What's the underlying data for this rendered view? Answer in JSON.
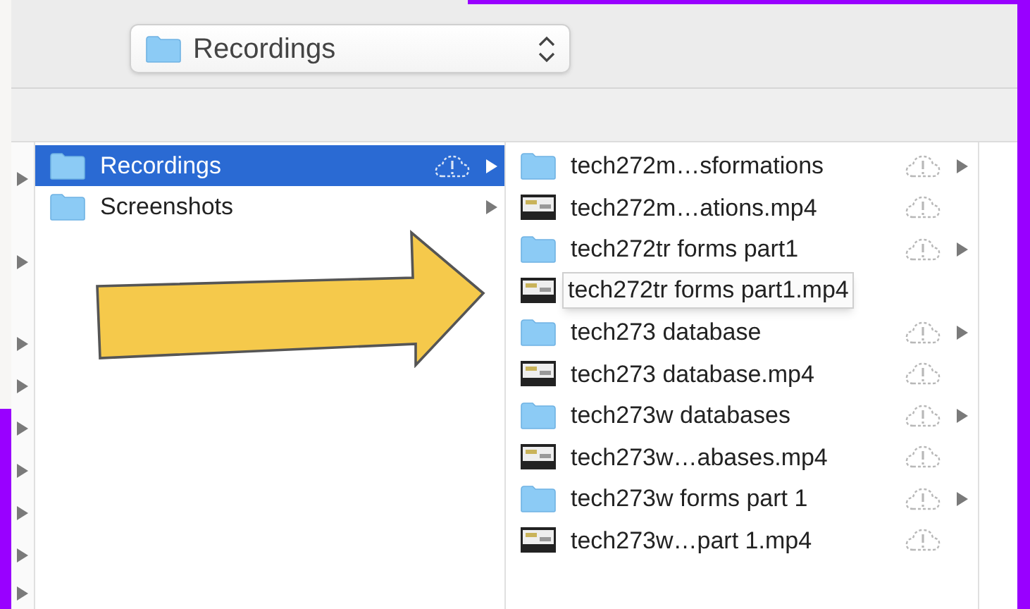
{
  "path_popup": {
    "label": "Recordings"
  },
  "parent_column": [
    {
      "name": "Recordings",
      "kind": "folder",
      "selected": true,
      "cloud": true
    },
    {
      "name": "Screenshots",
      "kind": "folder",
      "selected": false,
      "cloud": false
    }
  ],
  "contents_column": [
    {
      "name": "tech272m…sformations",
      "kind": "folder",
      "cloud": true,
      "expanded": false
    },
    {
      "name": "tech272m…ations.mp4",
      "kind": "video",
      "cloud": true,
      "expanded": false
    },
    {
      "name": "tech272tr forms part1",
      "kind": "folder",
      "cloud": true,
      "expanded": false
    },
    {
      "name": "tech272tr forms part1.mp4",
      "kind": "video",
      "cloud": false,
      "expanded": true
    },
    {
      "name": "tech273 database",
      "kind": "folder",
      "cloud": true,
      "expanded": false
    },
    {
      "name": "tech273 database.mp4",
      "kind": "video",
      "cloud": true,
      "expanded": false
    },
    {
      "name": "tech273w databases",
      "kind": "folder",
      "cloud": true,
      "expanded": false
    },
    {
      "name": "tech273w…abases.mp4",
      "kind": "video",
      "cloud": true,
      "expanded": false
    },
    {
      "name": "tech273w forms part 1",
      "kind": "folder",
      "cloud": true,
      "expanded": false
    },
    {
      "name": "tech273w…part 1.mp4",
      "kind": "video",
      "cloud": true,
      "expanded": false
    }
  ]
}
